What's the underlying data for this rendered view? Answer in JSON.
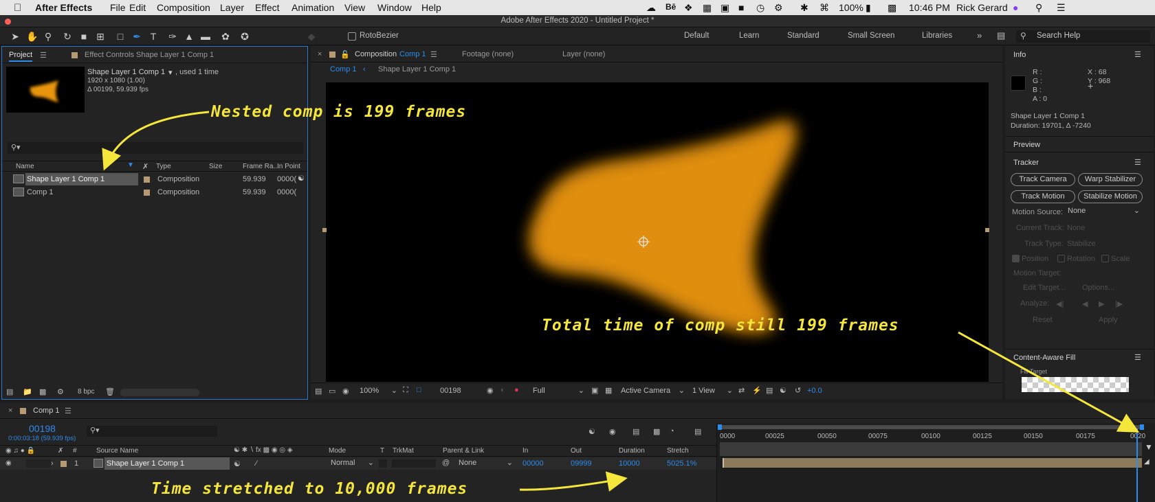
{
  "menubar": {
    "app": "After Effects",
    "items": [
      "File",
      "Edit",
      "Composition",
      "Layer",
      "Effect",
      "Animation",
      "View",
      "Window",
      "Help"
    ],
    "battery": "100%",
    "clock": "10:46 PM",
    "user": "Rick Gerard"
  },
  "window": {
    "title": "Adobe After Effects 2020 - Untitled Project *"
  },
  "toolbar": {
    "rotobezier": "RotoBezier",
    "workspaces": [
      "Default",
      "Learn",
      "Standard",
      "Small Screen",
      "Libraries"
    ],
    "search_placeholder": "Search Help"
  },
  "project": {
    "tab": "Project",
    "effect_tab": "Effect Controls Shape Layer 1 Comp 1",
    "selected_name": "Shape Layer 1 Comp 1",
    "used": ", used 1 time",
    "dims": "1920 x 1080 (1.00)",
    "duration": "Δ 00199, 59.939 fps",
    "columns": {
      "name": "Name",
      "type": "Type",
      "size": "Size",
      "framerate": "Frame Ra...",
      "inpoint": "In Point"
    },
    "rows": [
      {
        "name": "Shape Layer 1 Comp 1",
        "type": "Composition",
        "fps": "59.939",
        "in": "0000("
      },
      {
        "name": "Comp 1",
        "type": "Composition",
        "fps": "59.939",
        "in": "0000("
      }
    ],
    "bpc": "8 bpc"
  },
  "composition": {
    "tab_prefix": "Composition",
    "tab_name": "Comp 1",
    "footage": "Footage (none)",
    "layer": "Layer (none)",
    "breadcrumb_active": "Comp 1",
    "breadcrumb_next": "Shape Layer 1 Comp 1",
    "zoom": "100%",
    "frame": "00198",
    "resolution": "Full",
    "camera": "Active Camera",
    "views": "1 View",
    "exposure": "+0.0"
  },
  "info": {
    "title": "Info",
    "r": "R :",
    "g": "G :",
    "b": "B :",
    "a": "A :  0",
    "x": "X : 68",
    "y": "Y :  968",
    "layer_name": "Shape Layer 1 Comp 1",
    "layer_duration": "Duration: 19701, Δ -7240"
  },
  "preview": {
    "title": "Preview"
  },
  "tracker": {
    "title": "Tracker",
    "buttons": [
      "Track Camera",
      "Warp Stabilizer",
      "Track Motion",
      "Stabilize Motion"
    ],
    "motion_source_label": "Motion Source:",
    "motion_source": "None",
    "current_track_label": "Current Track:",
    "current_track": "None",
    "track_type_label": "Track Type:",
    "track_type": "Stabilize",
    "position": "Position",
    "rotation": "Rotation",
    "scale": "Scale",
    "motion_target": "Motion Target:",
    "edit_target": "Edit Target...",
    "options": "Options...",
    "analyze": "Analyze:",
    "reset": "Reset",
    "apply": "Apply"
  },
  "caf": {
    "title": "Content-Aware Fill",
    "fill_target": "Fill Target"
  },
  "timeline": {
    "tab": "Comp 1",
    "timecode": "00198",
    "timecode_sub": "0:00:03:18 (59.939 fps)",
    "columns": {
      "source": "Source Name",
      "mode": "Mode",
      "t": "T",
      "trkmat": "TrkMat",
      "parent": "Parent & Link",
      "in": "In",
      "out": "Out",
      "duration": "Duration",
      "stretch": "Stretch",
      "num": "#"
    },
    "layer": {
      "num": "1",
      "name": "Shape Layer 1 Comp 1",
      "mode": "Normal",
      "parent": "None",
      "in": "00000",
      "out": "09999",
      "duration": "10000",
      "stretch": "5025.1%"
    },
    "ruler": [
      "0000",
      "00025",
      "00050",
      "00075",
      "00100",
      "00125",
      "00150",
      "00175",
      "0020"
    ]
  },
  "annotations": {
    "nested": "Nested comp is 199 frames",
    "total": "Total time of comp still 199 frames",
    "stretched": "Time stretched to 10,000 frames"
  },
  "colors": {
    "accent": "#2d8ceb",
    "annotation": "#f5e63b",
    "shape": "#e8940c"
  }
}
